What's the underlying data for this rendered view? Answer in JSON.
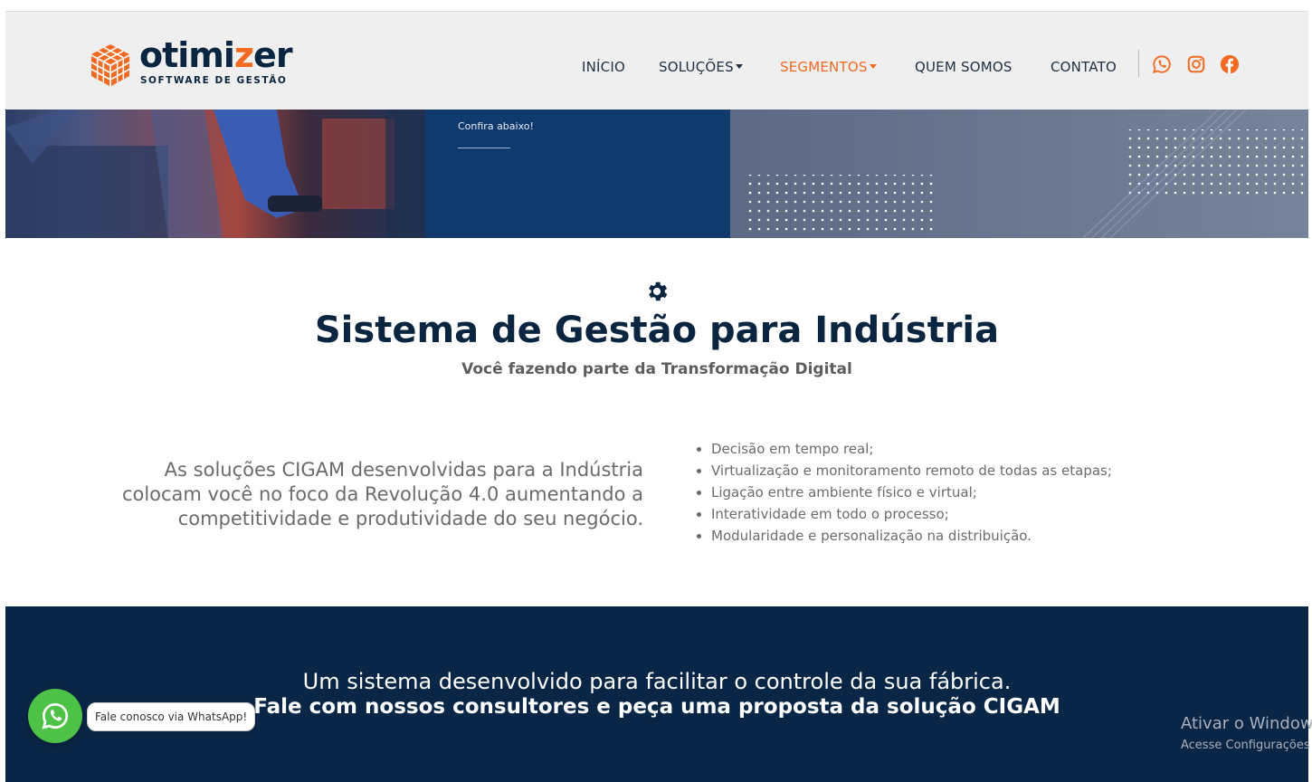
{
  "header": {
    "logo_text_main": "otimi",
    "logo_text_accent": "z",
    "logo_text_end": "er",
    "logo_tagline": "SOFTWARE DE GESTÃO"
  },
  "nav": {
    "items": [
      {
        "label": "INÍCIO"
      },
      {
        "label": "SOLUÇÕES"
      },
      {
        "label": "SEGMENTOS"
      },
      {
        "label": "QUEM SOMOS"
      },
      {
        "label": "CONTATO"
      }
    ],
    "social_icons": [
      "whatsapp-icon",
      "instagram-icon",
      "facebook-icon"
    ],
    "accent_color": "#f26a21"
  },
  "banner": {
    "confira_text": "Confira abaixo!"
  },
  "main": {
    "icon": "gear-icon",
    "title": "Sistema de Gestão para Indústria",
    "subtitle": "Você fazendo parte da Transformação Digital",
    "lead": "As soluções CIGAM desenvolvidas para a Indústria colocam você no foco da Revolução 4.0 aumentando a competitividade e produtividade do seu negócio.",
    "bullets": [
      "Decisão em tempo real;",
      "Virtualização e monitoramento remoto de todas as etapas;",
      "Ligação entre ambiente físico e virtual;",
      "Interatividade em todo o processo;",
      "Modularidade e personalização na distribuição."
    ]
  },
  "cta": {
    "line1": "Um sistema desenvolvido para facilitar o controle da sua fábrica.",
    "line2": "Fale com nossos consultores e peça uma proposta da solução CIGAM",
    "bg_color": "#0a2646"
  },
  "whatsapp_float": {
    "label": "Fale conosco via WhatsApp!",
    "color": "#4dc247"
  },
  "windows_activation": {
    "title": "Ativar o Windows",
    "subtitle": "Acesse Configurações"
  }
}
